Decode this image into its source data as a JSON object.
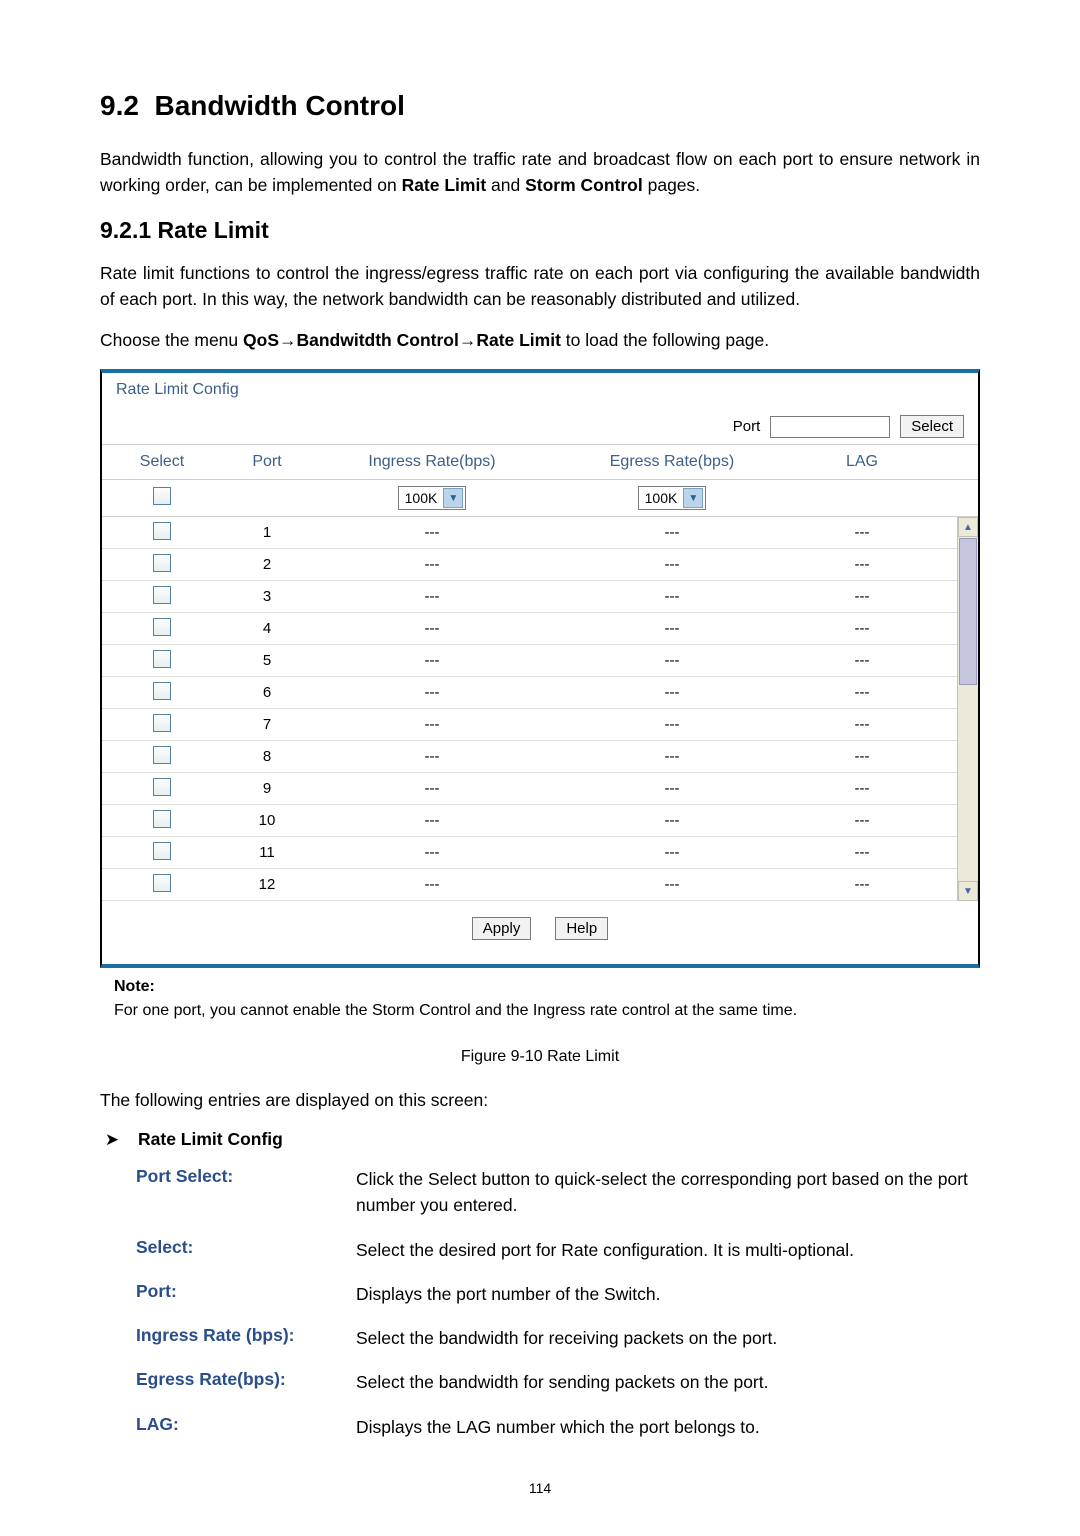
{
  "section_number": "9.2",
  "section_title": "Bandwidth Control",
  "intro_para_html": "Bandwidth function, allowing you to control the traffic rate and broadcast flow on each port to ensure network in working order, can be implemented on <b>Rate Limit</b> and <b>Storm Control</b> pages.",
  "subsection_number": "9.2.1",
  "subsection_title": "Rate Limit",
  "sub_para": "Rate limit functions to control the ingress/egress traffic rate on each port via configuring the available bandwidth of each port. In this way, the network bandwidth can be reasonably distributed and utilized.",
  "menu_line_html": "Choose the menu <b>QoS→Bandwitdth Control→Rate Limit</b> to load the following page.",
  "panel": {
    "title": "Rate Limit Config",
    "port_label": "Port",
    "port_value": "",
    "select_btn": "Select",
    "headers": {
      "select": "Select",
      "port": "Port",
      "ingress": "Ingress Rate(bps)",
      "egress": "Egress Rate(bps)",
      "lag": "LAG"
    },
    "rate_options": {
      "ingress": "100K",
      "egress": "100K"
    },
    "rows": [
      {
        "port": "1",
        "ingress": "---",
        "egress": "---",
        "lag": "---"
      },
      {
        "port": "2",
        "ingress": "---",
        "egress": "---",
        "lag": "---"
      },
      {
        "port": "3",
        "ingress": "---",
        "egress": "---",
        "lag": "---"
      },
      {
        "port": "4",
        "ingress": "---",
        "egress": "---",
        "lag": "---"
      },
      {
        "port": "5",
        "ingress": "---",
        "egress": "---",
        "lag": "---"
      },
      {
        "port": "6",
        "ingress": "---",
        "egress": "---",
        "lag": "---"
      },
      {
        "port": "7",
        "ingress": "---",
        "egress": "---",
        "lag": "---"
      },
      {
        "port": "8",
        "ingress": "---",
        "egress": "---",
        "lag": "---"
      },
      {
        "port": "9",
        "ingress": "---",
        "egress": "---",
        "lag": "---"
      },
      {
        "port": "10",
        "ingress": "---",
        "egress": "---",
        "lag": "---"
      },
      {
        "port": "11",
        "ingress": "---",
        "egress": "---",
        "lag": "---"
      },
      {
        "port": "12",
        "ingress": "---",
        "egress": "---",
        "lag": "---"
      }
    ],
    "apply_btn": "Apply",
    "help_btn": "Help"
  },
  "note_label": "Note:",
  "note_text": "For one port, you cannot enable the Storm Control and the Ingress rate control at the same time.",
  "figure_caption": "Figure 9-10 Rate Limit",
  "entries_text": "The following entries are displayed on this screen:",
  "bullet_label": "Rate Limit Config",
  "definitions": [
    {
      "term": "Port Select:",
      "desc": "Click the Select button to quick-select the corresponding port based on the port number you entered."
    },
    {
      "term": "Select:",
      "desc": "Select the desired port for Rate configuration. It is multi-optional."
    },
    {
      "term": "Port:",
      "desc": "Displays the port number of the Switch."
    },
    {
      "term": "Ingress Rate (bps):",
      "desc": "Select the bandwidth for receiving packets on the port."
    },
    {
      "term": "Egress Rate(bps):",
      "desc": "Select the bandwidth for sending packets on the port."
    },
    {
      "term": "LAG:",
      "desc": "Displays the LAG number which the port belongs to."
    }
  ],
  "page_number": "114"
}
